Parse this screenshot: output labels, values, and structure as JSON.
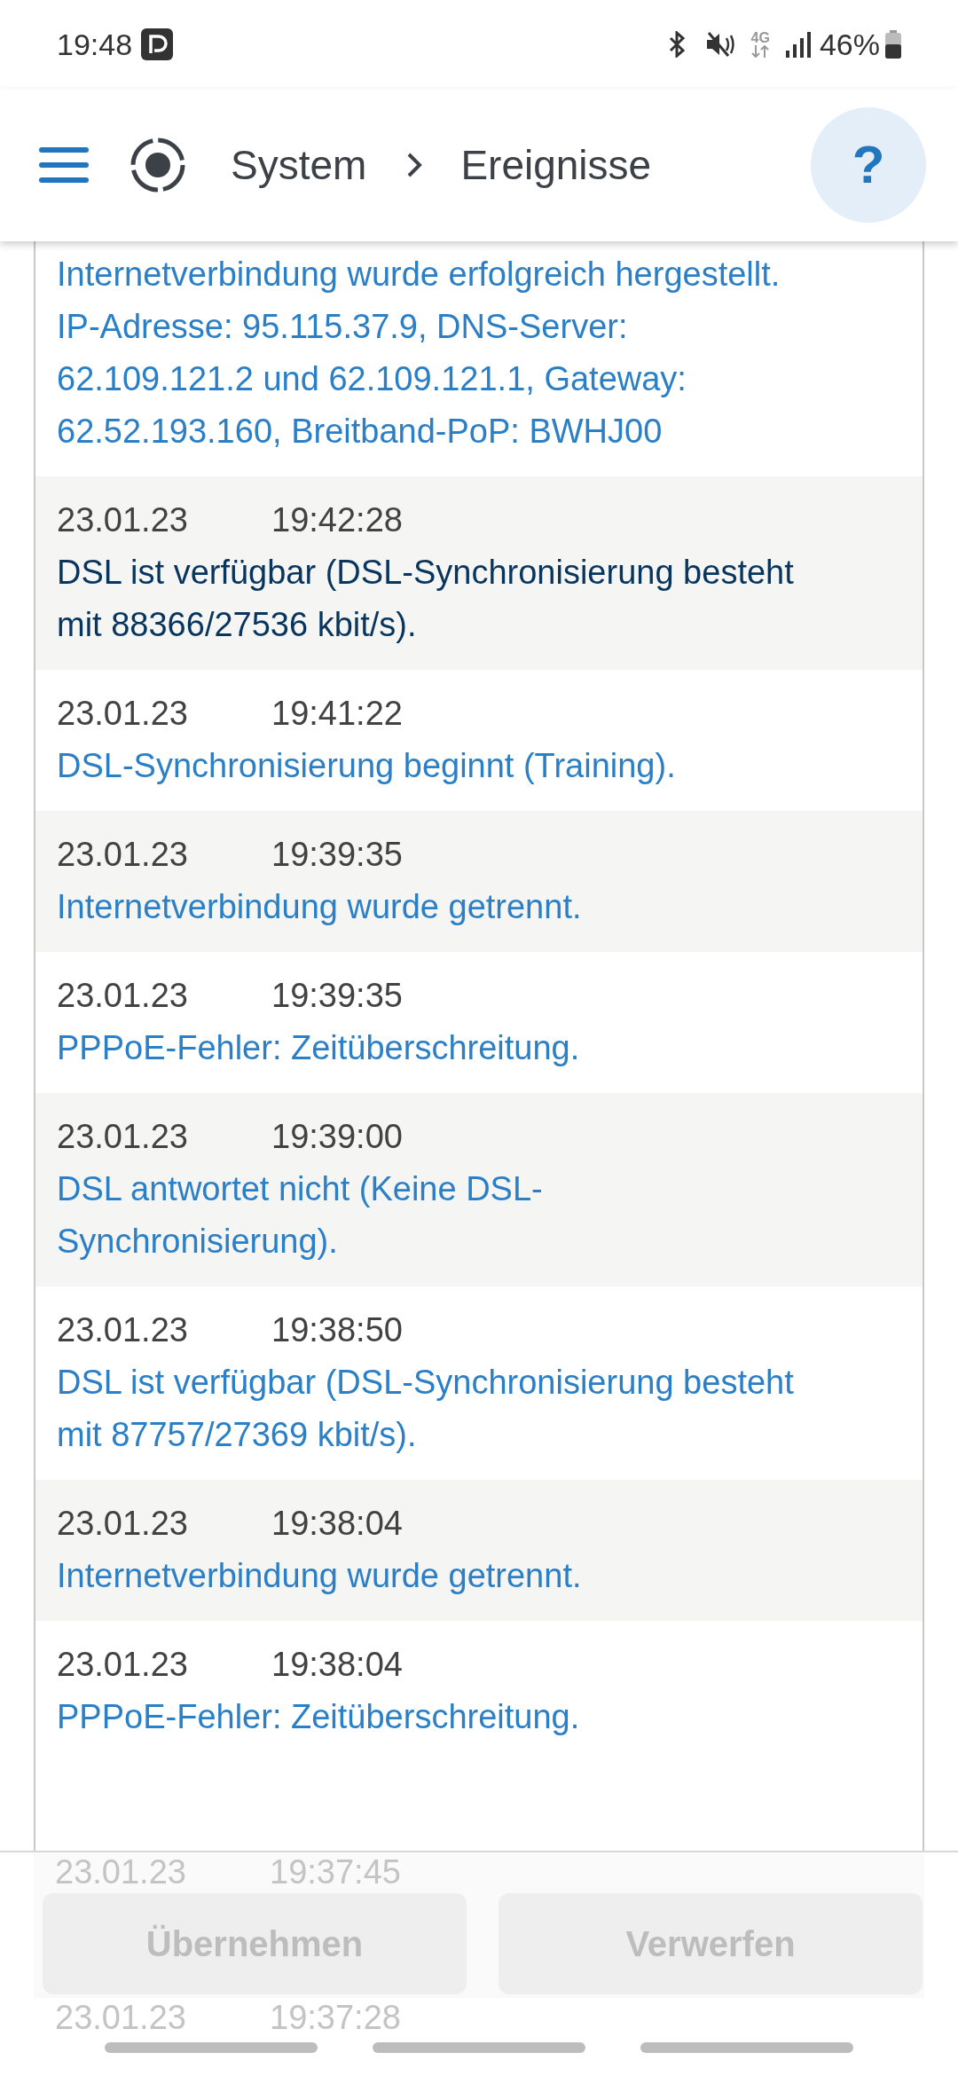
{
  "status_bar": {
    "time": "19:48",
    "network": "4G",
    "battery": "46%"
  },
  "header": {
    "breadcrumb": [
      "System",
      "Ereignisse"
    ],
    "help": "?"
  },
  "events": [
    {
      "message": "Internetverbindung wurde erfolgreich hergestellt. IP-Adresse: 95.115.37.9, DNS-Server: 62.109.121.2 und 62.109.121.1, Gateway: 62.52.193.160, Breitband-PoP: BWHJ00",
      "selected": false,
      "covered": false
    },
    {
      "date": "23.01.23",
      "time": "19:42:28",
      "message": "DSL ist verfügbar (DSL-Synchronisierung besteht mit 88366/27536 kbit/s).",
      "selected": true,
      "covered": false
    },
    {
      "date": "23.01.23",
      "time": "19:41:22",
      "message": "DSL-Synchronisierung beginnt (Training).",
      "selected": false,
      "covered": false
    },
    {
      "date": "23.01.23",
      "time": "19:39:35",
      "message": "Internetverbindung wurde getrennt.",
      "selected": false,
      "covered": false
    },
    {
      "date": "23.01.23",
      "time": "19:39:35",
      "message": "PPPoE-Fehler: Zeitüberschreitung.",
      "selected": false,
      "covered": false
    },
    {
      "date": "23.01.23",
      "time": "19:39:00",
      "message": "DSL antwortet nicht (Keine DSL-Synchronisierung).",
      "selected": false,
      "covered": false
    },
    {
      "date": "23.01.23",
      "time": "19:38:50",
      "message": "DSL ist verfügbar (DSL-Synchronisierung besteht mit 87757/27369 kbit/s).",
      "selected": false,
      "covered": false
    },
    {
      "date": "23.01.23",
      "time": "19:38:04",
      "message": "Internetverbindung wurde getrennt.",
      "selected": false,
      "covered": false
    },
    {
      "date": "23.01.23",
      "time": "19:38:04",
      "message": "PPPoE-Fehler: Zeitüberschreitung.",
      "selected": false,
      "covered": false
    },
    {
      "date": "23.01.23",
      "time": "19:37:45",
      "selected": false,
      "covered": true
    },
    {
      "date": "23.01.23",
      "time": "19:37:28",
      "selected": false,
      "covered": true
    }
  ],
  "buttons": [
    {
      "label": "Übernehmen",
      "disabled": true
    },
    {
      "label": "Verwerfen",
      "disabled": true
    }
  ]
}
